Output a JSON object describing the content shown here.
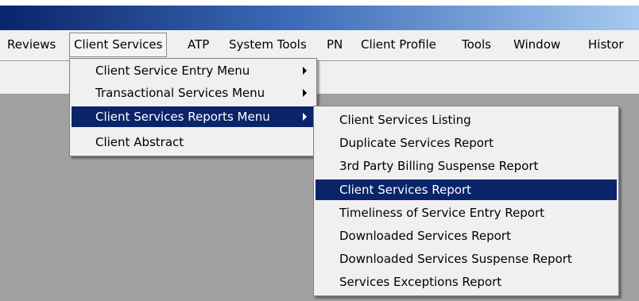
{
  "menubar": {
    "items": [
      "Reviews",
      "Client Services",
      "ATP",
      "System Tools",
      "PN",
      "Client Profile",
      "Tools",
      "Window",
      "Histor"
    ]
  },
  "client_services_menu": {
    "items": [
      {
        "label": "Client Service Entry Menu",
        "has_submenu": true
      },
      {
        "label": "Transactional Services Menu",
        "has_submenu": true
      },
      {
        "label": "Client Services Reports Menu",
        "has_submenu": true,
        "selected": true
      },
      {
        "label": "Client Abstract",
        "has_submenu": false
      }
    ]
  },
  "reports_submenu": {
    "items": [
      {
        "label": "Client Services Listing"
      },
      {
        "label": "Duplicate Services Report"
      },
      {
        "label": "3rd Party Billing Suspense Report"
      },
      {
        "label": "Client Services Report",
        "selected": true
      },
      {
        "label": "Timeliness of Service Entry Report"
      },
      {
        "label": "Downloaded Services Report"
      },
      {
        "label": "Downloaded Services Suspense Report"
      },
      {
        "label": "Services Exceptions Report"
      }
    ]
  },
  "colors": {
    "selection": "#0a246a",
    "menu_bg": "#f0f0f0",
    "workspace_bg": "#a0a0a0"
  },
  "icons": [
    "submenu-arrow-icon"
  ]
}
